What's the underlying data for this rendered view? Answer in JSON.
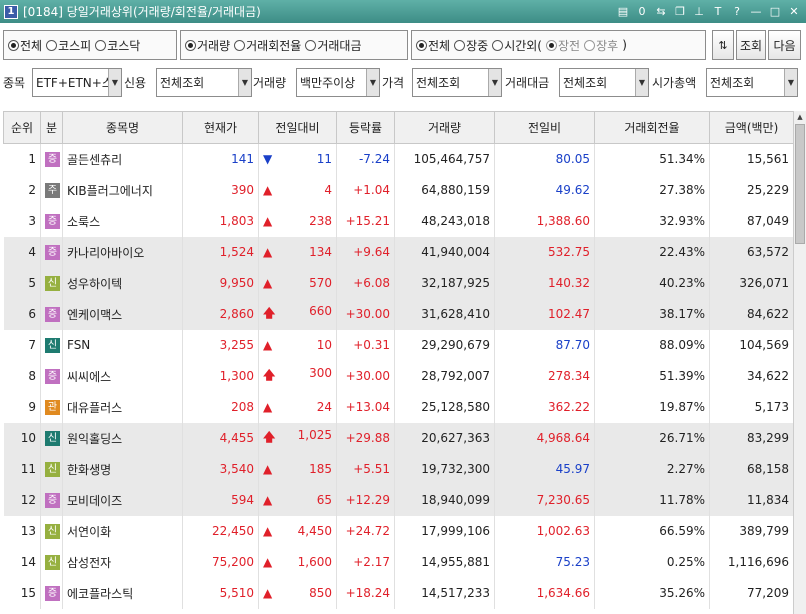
{
  "window": {
    "screen_no": "1",
    "title": "[0184] 당일거래상위(거래량/회전율/거래대금)"
  },
  "market": {
    "options": [
      "전체",
      "코스피",
      "코스닥"
    ],
    "selected": 0
  },
  "metric": {
    "options": [
      "거래량",
      "거래회전율",
      "거래대금"
    ],
    "selected": 0
  },
  "session": {
    "options": [
      "전체",
      "장중",
      "시간외("
    ],
    "selected": 0,
    "sub_options": [
      "장전",
      "장후"
    ],
    "close_paren": ")"
  },
  "buttons": {
    "query": "조회",
    "next": "다음"
  },
  "filters": {
    "item_label": "종목",
    "item_value": "ETF+ETN+스",
    "credit_label": "신용",
    "credit_value": "전체조회",
    "volume_label": "거래량",
    "volume_value": "백만주이상",
    "price_label": "가격",
    "price_value": "전체조회",
    "amount_label": "거래대금",
    "amount_value": "전체조회",
    "mcap_label": "시가총액",
    "mcap_value": "전체조회"
  },
  "table": {
    "headers": [
      "순위",
      "분",
      "종목명",
      "현재가",
      "전일대비",
      "등락률",
      "거래량",
      "전일비",
      "거래회전율",
      "금액(백만)"
    ],
    "rows": [
      {
        "rank": "1",
        "tag": "증",
        "tag_color": "#c070c0",
        "name": "골든센츄리",
        "price": "141",
        "dir": "dn",
        "change": "11",
        "rate": "-7.24",
        "volume": "105,464,757",
        "prev": "80.05",
        "prev_dir": "dn",
        "turnover": "51.34%",
        "amount": "15,561",
        "gray": false
      },
      {
        "rank": "2",
        "tag": "주",
        "tag_color": "#7a7a7a",
        "name": "KIB플러그에너지",
        "price": "390",
        "dir": "up",
        "change": "4",
        "rate": "+1.04",
        "volume": "64,880,159",
        "prev": "49.62",
        "prev_dir": "dn",
        "turnover": "27.38%",
        "amount": "25,229",
        "gray": false
      },
      {
        "rank": "3",
        "tag": "증",
        "tag_color": "#c070c0",
        "name": "소룩스",
        "price": "1,803",
        "dir": "up",
        "change": "238",
        "rate": "+15.21",
        "volume": "48,243,018",
        "prev": "1,388.60",
        "prev_dir": "up",
        "turnover": "32.93%",
        "amount": "87,049",
        "gray": false
      },
      {
        "rank": "4",
        "tag": "증",
        "tag_color": "#c070c0",
        "name": "카나리아바이오",
        "price": "1,524",
        "dir": "up",
        "change": "134",
        "rate": "+9.64",
        "volume": "41,940,004",
        "prev": "532.75",
        "prev_dir": "up",
        "turnover": "22.43%",
        "amount": "63,572",
        "gray": true
      },
      {
        "rank": "5",
        "tag": "신",
        "tag_color": "#96b040",
        "name": "성우하이텍",
        "price": "9,950",
        "dir": "up",
        "change": "570",
        "rate": "+6.08",
        "volume": "32,187,925",
        "prev": "140.32",
        "prev_dir": "up",
        "turnover": "40.23%",
        "amount": "326,071",
        "gray": true
      },
      {
        "rank": "6",
        "tag": "증",
        "tag_color": "#c070c0",
        "name": "엔케이맥스",
        "price": "2,860",
        "dir": "uparr",
        "change": "660",
        "rate": "+30.00",
        "volume": "31,628,410",
        "prev": "102.47",
        "prev_dir": "up",
        "turnover": "38.17%",
        "amount": "84,622",
        "gray": true
      },
      {
        "rank": "7",
        "tag": "신",
        "tag_color": "#1e7b70",
        "name": "FSN",
        "price": "3,255",
        "dir": "up",
        "change": "10",
        "rate": "+0.31",
        "volume": "29,290,679",
        "prev": "87.70",
        "prev_dir": "dn",
        "turnover": "88.09%",
        "amount": "104,569",
        "gray": false
      },
      {
        "rank": "8",
        "tag": "증",
        "tag_color": "#c070c0",
        "name": "씨씨에스",
        "price": "1,300",
        "dir": "uparr",
        "change": "300",
        "rate": "+30.00",
        "volume": "28,792,007",
        "prev": "278.34",
        "prev_dir": "up",
        "turnover": "51.39%",
        "amount": "34,622",
        "gray": false
      },
      {
        "rank": "9",
        "tag": "관",
        "tag_color": "#e08a20",
        "name": "대유플러스",
        "price": "208",
        "dir": "up",
        "change": "24",
        "rate": "+13.04",
        "volume": "25,128,580",
        "prev": "362.22",
        "prev_dir": "up",
        "turnover": "19.87%",
        "amount": "5,173",
        "gray": false
      },
      {
        "rank": "10",
        "tag": "신",
        "tag_color": "#1e7b70",
        "name": "원익홀딩스",
        "price": "4,455",
        "dir": "uparr",
        "change": "1,025",
        "rate": "+29.88",
        "volume": "20,627,363",
        "prev": "4,968.64",
        "prev_dir": "up",
        "turnover": "26.71%",
        "amount": "83,299",
        "gray": true
      },
      {
        "rank": "11",
        "tag": "신",
        "tag_color": "#96b040",
        "name": "한화생명",
        "price": "3,540",
        "dir": "up",
        "change": "185",
        "rate": "+5.51",
        "volume": "19,732,300",
        "prev": "45.97",
        "prev_dir": "dn",
        "turnover": "2.27%",
        "amount": "68,158",
        "gray": true
      },
      {
        "rank": "12",
        "tag": "증",
        "tag_color": "#c070c0",
        "name": "모비데이즈",
        "price": "594",
        "dir": "up",
        "change": "65",
        "rate": "+12.29",
        "volume": "18,940,099",
        "prev": "7,230.65",
        "prev_dir": "up",
        "turnover": "11.78%",
        "amount": "11,834",
        "gray": true
      },
      {
        "rank": "13",
        "tag": "신",
        "tag_color": "#96b040",
        "name": "서연이화",
        "price": "22,450",
        "dir": "up",
        "change": "4,450",
        "rate": "+24.72",
        "volume": "17,999,106",
        "prev": "1,002.63",
        "prev_dir": "up",
        "turnover": "66.59%",
        "amount": "389,799",
        "gray": false
      },
      {
        "rank": "14",
        "tag": "신",
        "tag_color": "#96b040",
        "name": "삼성전자",
        "price": "75,200",
        "dir": "up",
        "change": "1,600",
        "rate": "+2.17",
        "volume": "14,955,881",
        "prev": "75.23",
        "prev_dir": "dn",
        "turnover": "0.25%",
        "amount": "1,116,696",
        "gray": false
      },
      {
        "rank": "15",
        "tag": "증",
        "tag_color": "#c070c0",
        "name": "에코플라스틱",
        "price": "5,510",
        "dir": "up",
        "change": "850",
        "rate": "+18.24",
        "volume": "14,517,233",
        "prev": "1,634.66",
        "prev_dir": "up",
        "turnover": "35.26%",
        "amount": "77,209",
        "gray": false
      }
    ]
  }
}
